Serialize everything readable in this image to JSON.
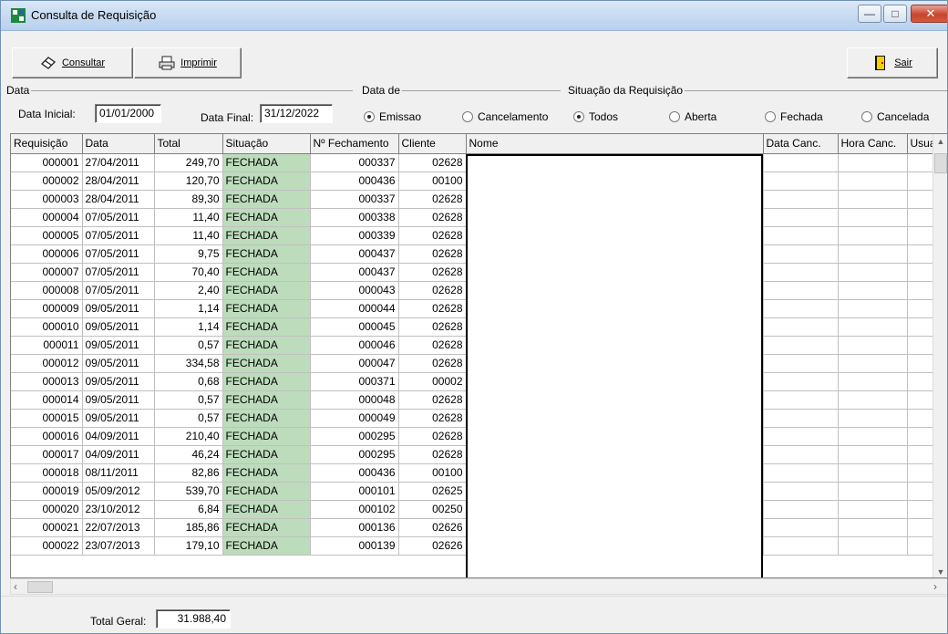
{
  "window": {
    "title": "Consulta de Requisição",
    "minimize_glyph": "—",
    "maximize_glyph": "□",
    "close_glyph": "✕"
  },
  "toolbar": {
    "consultar_label": "Consultar",
    "imprimir_label": "Imprimir",
    "sair_label": "Sair"
  },
  "filters": {
    "data_group": "Data",
    "data_inicial_label": "Data Inicial:",
    "data_inicial_value": "01/01/2000",
    "data_final_label": "Data Final:",
    "data_final_value": "31/12/2022",
    "data_de_group": "Data de",
    "data_de_options": [
      {
        "label": "Emissao",
        "selected": true
      },
      {
        "label": "Cancelamento",
        "selected": false
      }
    ],
    "situacao_group": "Situação da Requisição",
    "situacao_options": [
      {
        "label": "Todos",
        "selected": true
      },
      {
        "label": "Aberta",
        "selected": false
      },
      {
        "label": "Fechada",
        "selected": false
      },
      {
        "label": "Cancelada",
        "selected": false
      }
    ]
  },
  "grid": {
    "columns": [
      "Requisição",
      "Data",
      "Total",
      "Situação",
      "Nº Fechamento",
      "Cliente",
      "Nome",
      "Data Canc.",
      "Hora Canc.",
      "Usua"
    ],
    "rows": [
      [
        "000001",
        "27/04/2011",
        "249,70",
        "FECHADA",
        "000337",
        "02628"
      ],
      [
        "000002",
        "28/04/2011",
        "120,70",
        "FECHADA",
        "000436",
        "00100"
      ],
      [
        "000003",
        "28/04/2011",
        "89,30",
        "FECHADA",
        "000337",
        "02628"
      ],
      [
        "000004",
        "07/05/2011",
        "11,40",
        "FECHADA",
        "000338",
        "02628"
      ],
      [
        "000005",
        "07/05/2011",
        "11,40",
        "FECHADA",
        "000339",
        "02628"
      ],
      [
        "000006",
        "07/05/2011",
        "9,75",
        "FECHADA",
        "000437",
        "02628"
      ],
      [
        "000007",
        "07/05/2011",
        "70,40",
        "FECHADA",
        "000437",
        "02628"
      ],
      [
        "000008",
        "07/05/2011",
        "2,40",
        "FECHADA",
        "000043",
        "02628"
      ],
      [
        "000009",
        "09/05/2011",
        "1,14",
        "FECHADA",
        "000044",
        "02628"
      ],
      [
        "000010",
        "09/05/2011",
        "1,14",
        "FECHADA",
        "000045",
        "02628"
      ],
      [
        "000011",
        "09/05/2011",
        "0,57",
        "FECHADA",
        "000046",
        "02628"
      ],
      [
        "000012",
        "09/05/2011",
        "334,58",
        "FECHADA",
        "000047",
        "02628"
      ],
      [
        "000013",
        "09/05/2011",
        "0,68",
        "FECHADA",
        "000371",
        "00002"
      ],
      [
        "000014",
        "09/05/2011",
        "0,57",
        "FECHADA",
        "000048",
        "02628"
      ],
      [
        "000015",
        "09/05/2011",
        "0,57",
        "FECHADA",
        "000049",
        "02628"
      ],
      [
        "000016",
        "04/09/2011",
        "210,40",
        "FECHADA",
        "000295",
        "02628"
      ],
      [
        "000017",
        "04/09/2011",
        "46,24",
        "FECHADA",
        "000295",
        "02628"
      ],
      [
        "000018",
        "08/11/2011",
        "82,86",
        "FECHADA",
        "000436",
        "00100"
      ],
      [
        "000019",
        "05/09/2012",
        "539,70",
        "FECHADA",
        "000101",
        "02625"
      ],
      [
        "000020",
        "23/10/2012",
        "6,84",
        "FECHADA",
        "000102",
        "00250"
      ],
      [
        "000021",
        "22/07/2013",
        "185,86",
        "FECHADA",
        "000136",
        "02626"
      ],
      [
        "000022",
        "23/07/2013",
        "179,10",
        "FECHADA",
        "000139",
        "02626"
      ]
    ]
  },
  "footer": {
    "total_label": "Total Geral:",
    "total_value": "31.988,40"
  },
  "colors": {
    "situacao_bg": "#bcdcbc",
    "close_red": "#c7452e"
  }
}
